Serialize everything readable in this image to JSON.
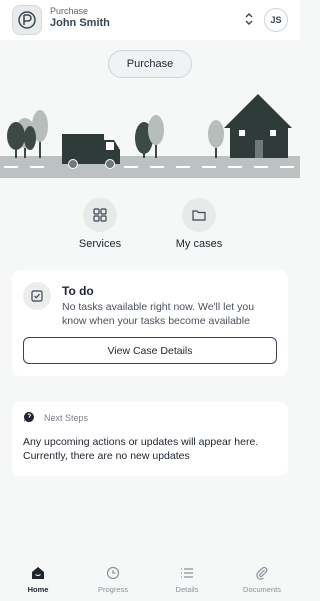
{
  "header": {
    "kicker": "Purchase",
    "name": "John Smith",
    "avatar_initials": "JS"
  },
  "primary_pill": {
    "label": "Purchase"
  },
  "shortcuts": [
    {
      "label": "Services",
      "icon": "grid-icon"
    },
    {
      "label": "My cases",
      "icon": "folder-icon"
    }
  ],
  "todo": {
    "title": "To do",
    "description": "No tasks available right now. We'll let you know when your tasks become available",
    "button_label": "View Case Details",
    "icon": "checkbox-icon"
  },
  "next_steps": {
    "title": "Next Steps",
    "body": "Any upcoming actions or updates will appear here. Currently, there are no new updates",
    "icon": "chat-bubble-icon"
  },
  "nav": [
    {
      "label": "Home",
      "icon": "home-icon",
      "active": true
    },
    {
      "label": "Progress",
      "icon": "clock-icon",
      "active": false
    },
    {
      "label": "Details",
      "icon": "list-icon",
      "active": false
    },
    {
      "label": "Documents",
      "icon": "paperclip-icon",
      "active": false
    }
  ],
  "colors": {
    "accent_dark": "#2f3b38",
    "road": "#bcc1c1",
    "tree_dark": "#3c4a45",
    "tree_light": "#b6bdbb",
    "background": "#f6f7f7"
  }
}
